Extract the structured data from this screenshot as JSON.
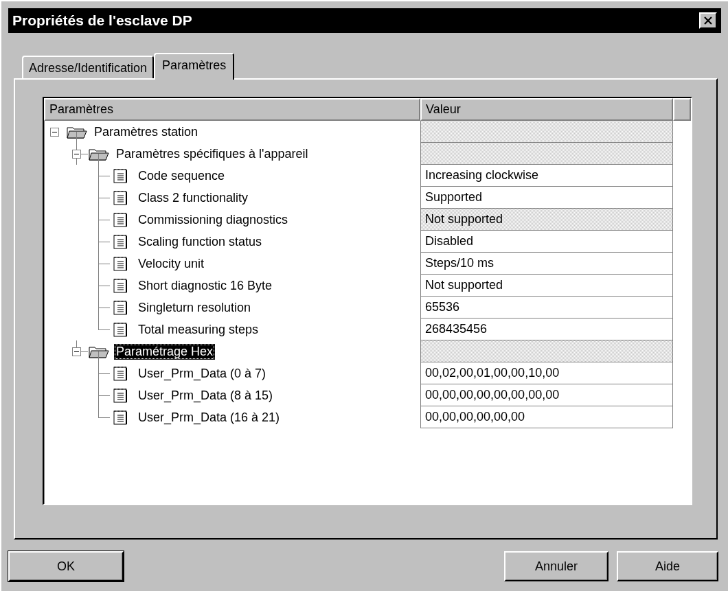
{
  "window": {
    "title": "Propriétés de l'esclave DP"
  },
  "tabs": [
    {
      "label": "Adresse/Identification",
      "selected": false
    },
    {
      "label": "Paramètres",
      "selected": true
    }
  ],
  "tree": {
    "columns": [
      "Paramètres",
      "Valeur"
    ],
    "items": [
      {
        "kind": "folder",
        "label": "Paramètres station",
        "expanded": true,
        "selected": false,
        "value": {
          "disabled": true
        },
        "children": [
          {
            "kind": "folder",
            "label": "Paramètres spécifiques à l'appareil",
            "expanded": true,
            "selected": false,
            "value": {
              "disabled": true
            },
            "children": [
              {
                "kind": "parameter",
                "label": "Code sequence",
                "selected": false,
                "value": {
                  "text": "Increasing clockwise",
                  "disabled": false
                }
              },
              {
                "kind": "parameter",
                "label": "Class 2 functionality",
                "selected": false,
                "value": {
                  "text": "Supported",
                  "disabled": false
                }
              },
              {
                "kind": "parameter",
                "label": "Commissioning diagnostics",
                "selected": false,
                "value": {
                  "text": "Not supported",
                  "disabled": true
                }
              },
              {
                "kind": "parameter",
                "label": "Scaling function status",
                "selected": false,
                "value": {
                  "text": "Disabled",
                  "disabled": false
                }
              },
              {
                "kind": "parameter",
                "label": "Velocity unit",
                "selected": false,
                "value": {
                  "text": "Steps/10 ms",
                  "disabled": false
                }
              },
              {
                "kind": "parameter",
                "label": "Short diagnostic 16 Byte",
                "selected": false,
                "value": {
                  "text": "Not supported",
                  "disabled": false
                }
              },
              {
                "kind": "parameter",
                "label": "Singleturn resolution",
                "selected": false,
                "value": {
                  "text": "65536",
                  "disabled": false
                }
              },
              {
                "kind": "parameter",
                "label": "Total measuring steps",
                "selected": false,
                "value": {
                  "text": "268435456",
                  "disabled": false
                }
              }
            ]
          },
          {
            "kind": "folder",
            "label": "Paramétrage Hex",
            "expanded": true,
            "selected": true,
            "value": {
              "disabled": true
            },
            "children": [
              {
                "kind": "parameter",
                "label": "User_Prm_Data (0 à 7)",
                "selected": false,
                "value": {
                  "text": "00,02,00,01,00,00,10,00",
                  "disabled": false
                }
              },
              {
                "kind": "parameter",
                "label": "User_Prm_Data (8 à 15)",
                "selected": false,
                "value": {
                  "text": "00,00,00,00,00,00,00,00",
                  "disabled": false
                }
              },
              {
                "kind": "parameter",
                "label": "User_Prm_Data (16 à 21)",
                "selected": false,
                "value": {
                  "text": "00,00,00,00,00,00",
                  "disabled": false
                }
              }
            ]
          }
        ]
      }
    ]
  },
  "buttons": [
    {
      "label": "OK",
      "default": true
    },
    {
      "label": "Annuler",
      "default": false
    },
    {
      "label": "Aide",
      "default": false
    }
  ]
}
